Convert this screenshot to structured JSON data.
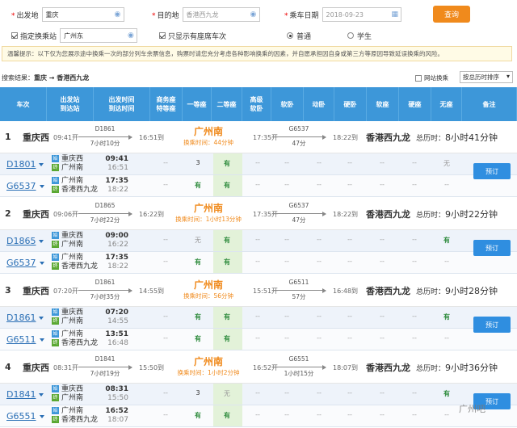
{
  "form": {
    "from_label": "出发地",
    "from_value": "重庆",
    "to_label": "目的地",
    "to_placeholder": "香港西九龙",
    "date_label": "乘车日期",
    "date_placeholder": "2018-09-23",
    "query_label": "查询",
    "transfer_label": "指定换乘站",
    "transfer_value": "广州东",
    "seat_label": "只显示有座席车次",
    "normal_label": "普通",
    "student_label": "学生"
  },
  "tip": "温馨提示：以下仅为您展示途中换乘一次的部分列车余票信息，购票时请您充分考虑各种影响换乘的因素，并自愿承担因自身或第三方等原因导致延误换乘的风险。",
  "summary": {
    "prefix": "搜索结果：",
    "route": "重庆 → 香港西九龙",
    "web_transfer": "网站换乘",
    "sort": "按总历时排序"
  },
  "columns": [
    "车次",
    "出发站\n到达站",
    "出发时间\n到达时间",
    "商务座\n特等座",
    "一等座",
    "二等座",
    "高级\n软卧",
    "软卧",
    "动卧",
    "硬卧",
    "软座",
    "硬座",
    "无座",
    "备注"
  ],
  "book_label": "预订",
  "results": [
    {
      "n": "1",
      "st": "重庆西",
      "dt": "09:41开",
      "t1": "D1861",
      "d1": "7小时10分",
      "a1": "16:51到",
      "city": "广州南",
      "wait": "换乘时间：44分钟",
      "dep2": "17:35开",
      "t2": "G6537",
      "d2": "47分",
      "a2": "18:22到",
      "dest": "香港西九龙",
      "total_l": "总历时：",
      "total": "8小时41分钟",
      "segs": [
        {
          "tn": "D1801",
          "s1": "重庆西",
          "s2": "广州南",
          "tm1": "09:41",
          "tm2": "16:51",
          "cells": [
            "--",
            "3",
            "有",
            "--",
            "--",
            "--",
            "--",
            "--",
            "--",
            "无"
          ]
        },
        {
          "tn": "G6537",
          "s1": "广州南",
          "s2": "香港西九龙",
          "tm1": "17:35",
          "tm2": "18:22",
          "cells": [
            "--",
            "有",
            "有",
            "--",
            "--",
            "--",
            "--",
            "--",
            "--",
            "--"
          ]
        }
      ]
    },
    {
      "n": "2",
      "st": "重庆西",
      "dt": "09:06开",
      "t1": "D1865",
      "d1": "7小时22分",
      "a1": "16:22到",
      "city": "广州南",
      "wait": "换乘时间：1小时13分钟",
      "dep2": "17:35开",
      "t2": "G6537",
      "d2": "47分",
      "a2": "18:22到",
      "dest": "香港西九龙",
      "total_l": "总历时：",
      "total": "9小时22分钟",
      "segs": [
        {
          "tn": "D1865",
          "s1": "重庆西",
          "s2": "广州南",
          "tm1": "09:00",
          "tm2": "16:22",
          "cells": [
            "--",
            "无",
            "有",
            "--",
            "--",
            "--",
            "--",
            "--",
            "--",
            "有"
          ]
        },
        {
          "tn": "G6537",
          "s1": "广州南",
          "s2": "香港西九龙",
          "tm1": "17:35",
          "tm2": "18:22",
          "cells": [
            "--",
            "有",
            "有",
            "--",
            "--",
            "--",
            "--",
            "--",
            "--",
            "--"
          ]
        }
      ]
    },
    {
      "n": "3",
      "st": "重庆西",
      "dt": "07:20开",
      "t1": "D1861",
      "d1": "7小时35分",
      "a1": "14:55到",
      "city": "广州南",
      "wait": "换乘时间：56分钟",
      "dep2": "15:51开",
      "t2": "G6511",
      "d2": "57分",
      "a2": "16:48到",
      "dest": "香港西九龙",
      "total_l": "总历时：",
      "total": "9小时28分钟",
      "segs": [
        {
          "tn": "D1861",
          "s1": "重庆西",
          "s2": "广州南",
          "tm1": "07:20",
          "tm2": "14:55",
          "cells": [
            "--",
            "有",
            "有",
            "--",
            "--",
            "--",
            "--",
            "--",
            "--",
            "有"
          ]
        },
        {
          "tn": "G6511",
          "s1": "广州南",
          "s2": "香港西九龙",
          "tm1": "13:51",
          "tm2": "16:48",
          "cells": [
            "--",
            "有",
            "有",
            "--",
            "--",
            "--",
            "--",
            "--",
            "--",
            "--"
          ]
        }
      ]
    },
    {
      "n": "4",
      "st": "重庆西",
      "dt": "08:31开",
      "t1": "D1841",
      "d1": "7小时19分",
      "a1": "15:50到",
      "city": "广州南",
      "wait": "换乘时间：1小时2分钟",
      "dep2": "16:52开",
      "t2": "G6551",
      "d2": "1小时15分",
      "a2": "18:07到",
      "dest": "香港西九龙",
      "total_l": "总历时：",
      "total": "9小时36分钟",
      "segs": [
        {
          "tn": "D1841",
          "s1": "重庆西",
          "s2": "广州南",
          "tm1": "08:31",
          "tm2": "15:50",
          "cells": [
            "--",
            "3",
            "无",
            "--",
            "--",
            "--",
            "--",
            "--",
            "--",
            "有"
          ]
        },
        {
          "tn": "G6551",
          "s1": "广州南",
          "s2": "香港西九龙",
          "tm1": "16:52",
          "tm2": "18:07",
          "cells": [
            "--",
            "有",
            "有",
            "--",
            "--",
            "--",
            "--",
            "--",
            "--",
            "--"
          ]
        }
      ]
    }
  ],
  "watermark": "广州吧"
}
